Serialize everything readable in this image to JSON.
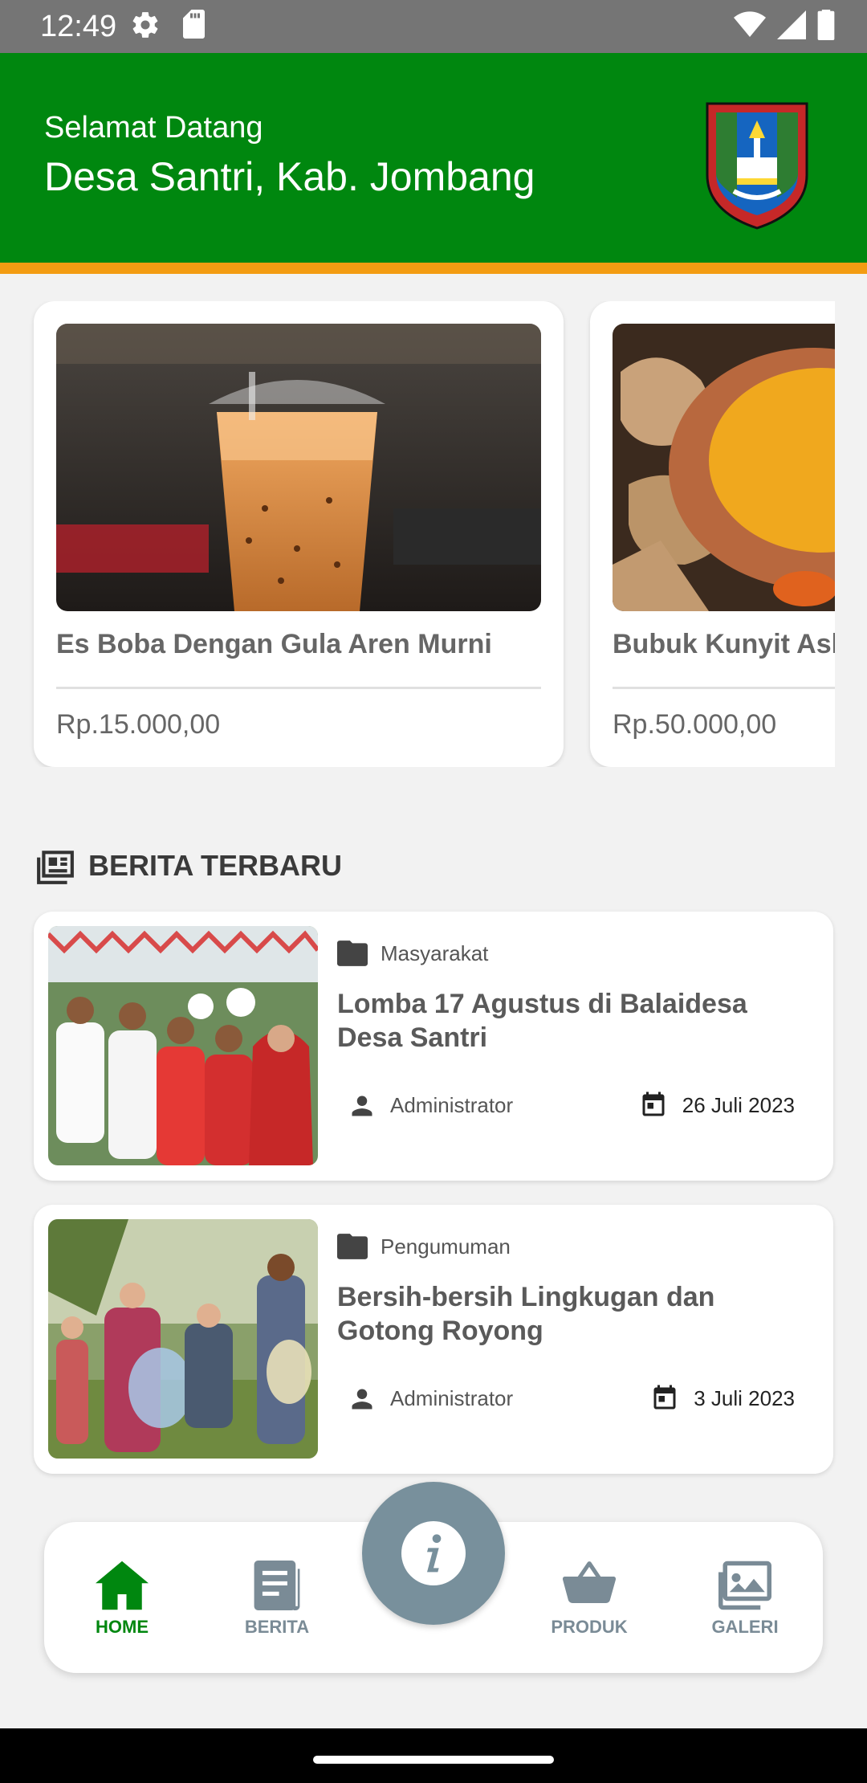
{
  "status_bar": {
    "time": "12:49"
  },
  "header": {
    "greeting": "Selamat Datang",
    "village": "Desa Santri, Kab. Jombang",
    "logo_icon": "kabupaten-jombang-emblem",
    "background": "#00870f",
    "stripe_color": "#f39c12"
  },
  "products": [
    {
      "name": "Es Boba Dengan Gula Aren Murni",
      "price": "Rp.15.000,00"
    },
    {
      "name": "Bubuk Kunyit Asli",
      "price": "Rp.50.000,00"
    }
  ],
  "news_section": {
    "title": "BERITA TERBARU"
  },
  "news": [
    {
      "category": "Masyarakat",
      "title": "Lomba 17 Agustus di Balaidesa Desa Santri",
      "author": "Administrator",
      "date": "26 Juli 2023"
    },
    {
      "category": "Pengumuman",
      "title": "Bersih-bersih Lingkugan dan Gotong Royong",
      "author": "Administrator",
      "date": "3 Juli 2023"
    }
  ],
  "bottom_nav": {
    "items": [
      {
        "label": "HOME",
        "icon": "home-icon",
        "active": true
      },
      {
        "label": "BERITA",
        "icon": "article-icon",
        "active": false
      },
      {
        "label": "PRODUK",
        "icon": "basket-icon",
        "active": false
      },
      {
        "label": "GALERI",
        "icon": "gallery-icon",
        "active": false
      }
    ],
    "fab_icon": "info-icon",
    "active_color": "#00870f",
    "inactive_color": "#7a8b96"
  }
}
